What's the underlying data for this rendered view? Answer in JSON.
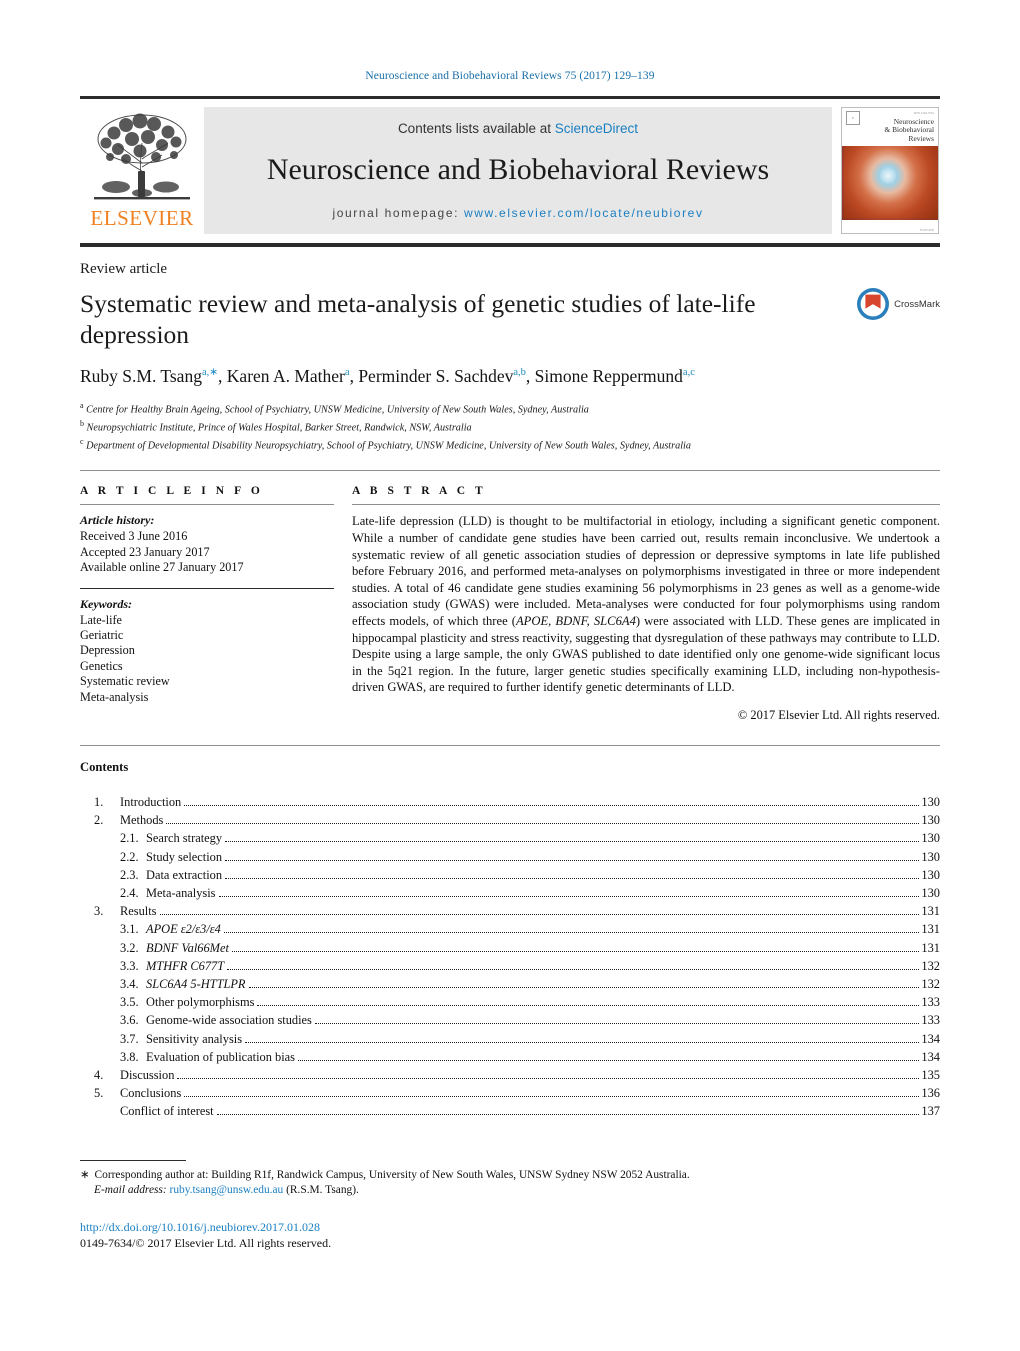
{
  "running_head": "Neuroscience and Biobehavioral Reviews 75 (2017) 129–139",
  "colors": {
    "link_blue": "#1a7fc1",
    "elsevier_orange": "#f08122",
    "running_head_blue": "#1a6fa8",
    "superscript_teal": "#1f8bbf",
    "masthead_gray": "#e7e7e7"
  },
  "masthead": {
    "contents_prefix": "Contents lists available at ",
    "contents_link": "ScienceDirect",
    "journal_title": "Neuroscience and Biobehavioral Reviews",
    "homepage_prefix": "journal homepage:",
    "homepage_url": "www.elsevier.com/locate/neubiorev",
    "publisher_wordmark": "ELSEVIER",
    "publisher_logo_icon": "elsevier-tree-icon",
    "cover": {
      "title_line_1": "Neuroscience",
      "title_line_2": "& Biobehavioral",
      "title_line_3": "Reviews",
      "top_meta": "ISSN 0149-7634",
      "bottom_meta": "ELSEVIER"
    }
  },
  "article": {
    "kicker": "Review article",
    "title": "Systematic review and meta-analysis of genetic studies of late-life depression",
    "crossmark_label": "CrossMark",
    "crossmark_icon": "crossmark-icon",
    "authors": [
      {
        "name": "Ruby S.M. Tsang",
        "sup": "a,∗"
      },
      {
        "name": "Karen A. Mather",
        "sup": "a"
      },
      {
        "name": "Perminder S. Sachdev",
        "sup": "a,b"
      },
      {
        "name": "Simone Reppermund",
        "sup": "a,c"
      }
    ],
    "affiliations": [
      {
        "marker": "a",
        "text": "Centre for Healthy Brain Ageing, School of Psychiatry, UNSW Medicine, University of New South Wales, Sydney, Australia"
      },
      {
        "marker": "b",
        "text": "Neuropsychiatric Institute, Prince of Wales Hospital, Barker Street, Randwick, NSW, Australia"
      },
      {
        "marker": "c",
        "text": "Department of Developmental Disability Neuropsychiatry, School of Psychiatry, UNSW Medicine, University of New South Wales, Sydney, Australia"
      }
    ]
  },
  "info": {
    "label": "A R T I C L E   I N F O",
    "history_head": "Article history:",
    "history": [
      "Received 3 June 2016",
      "Accepted 23 January 2017",
      "Available online 27 January 2017"
    ],
    "keywords_head": "Keywords:",
    "keywords": [
      "Late-life",
      "Geriatric",
      "Depression",
      "Genetics",
      "Systematic review",
      "Meta-analysis"
    ]
  },
  "abstract": {
    "label": "A B S T R A C T",
    "paragraph_part_1": "Late-life depression (LLD) is thought to be multifactorial in etiology, including a significant genetic component. While a number of candidate gene studies have been carried out, results remain inconclusive. We undertook a systematic review of all genetic association studies of depression or depressive symptoms in late life published before February 2016, and performed meta-analyses on polymorphisms investigated in three or more independent studies. A total of 46 candidate gene studies examining 56 polymorphisms in 23 genes as well as a genome-wide association study (GWAS) were included. Meta-analyses were conducted for four polymorphisms using random effects models, of which three (",
    "genes_italic": "APOE, BDNF, SLC6A4",
    "paragraph_part_2": ") were associated with LLD. These genes are implicated in hippocampal plasticity and stress reactivity, suggesting that dysregulation of these pathways may contribute to LLD. Despite using a large sample, the only GWAS published to date identified only one genome-wide significant locus in the 5q21 region. In the future, larger genetic studies specifically examining LLD, including non-hypothesis-driven GWAS, are required to further identify genetic determinants of LLD.",
    "copyright": "© 2017 Elsevier Ltd. All rights reserved."
  },
  "contents": {
    "heading": "Contents",
    "entries": [
      {
        "level": 1,
        "num": "1.",
        "label": "Introduction",
        "page": "130"
      },
      {
        "level": 1,
        "num": "2.",
        "label": "Methods",
        "page": "130"
      },
      {
        "level": 2,
        "num": "2.1.",
        "label": "Search strategy",
        "page": "130"
      },
      {
        "level": 2,
        "num": "2.2.",
        "label": "Study selection",
        "page": "130"
      },
      {
        "level": 2,
        "num": "2.3.",
        "label": "Data extraction",
        "page": "130"
      },
      {
        "level": 2,
        "num": "2.4.",
        "label": "Meta-analysis",
        "page": "130"
      },
      {
        "level": 1,
        "num": "3.",
        "label": "Results",
        "page": "131"
      },
      {
        "level": 2,
        "num": "3.1.",
        "label": "APOE ε2/ε3/ε4",
        "italic": true,
        "page": "131"
      },
      {
        "level": 2,
        "num": "3.2.",
        "label": "BDNF Val66Met",
        "italic": true,
        "page": "131"
      },
      {
        "level": 2,
        "num": "3.3.",
        "label": "MTHFR C677T",
        "italic": true,
        "page": "132"
      },
      {
        "level": 2,
        "num": "3.4.",
        "label": "SLC6A4 5-HTTLPR",
        "italic": true,
        "page": "132"
      },
      {
        "level": 2,
        "num": "3.5.",
        "label": "Other polymorphisms",
        "page": "133"
      },
      {
        "level": 2,
        "num": "3.6.",
        "label": "Genome-wide association studies",
        "page": "133"
      },
      {
        "level": 2,
        "num": "3.7.",
        "label": "Sensitivity analysis",
        "page": "134"
      },
      {
        "level": 2,
        "num": "3.8.",
        "label": "Evaluation of publication bias",
        "page": "134"
      },
      {
        "level": 1,
        "num": "4.",
        "label": "Discussion",
        "page": "135"
      },
      {
        "level": 1,
        "num": "5.",
        "label": "Conclusions",
        "page": "136"
      },
      {
        "level": 3,
        "num": "",
        "label": "Conflict of interest",
        "page": "137"
      }
    ]
  },
  "footnotes": {
    "star": "∗",
    "corresponding": "Corresponding author at: Building R1f, Randwick Campus, University of New South Wales, UNSW Sydney NSW 2052 Australia.",
    "email_label": "E-mail address:",
    "email": "ruby.tsang@unsw.edu.au",
    "email_suffix": "(R.S.M. Tsang).",
    "doi": "http://dx.doi.org/10.1016/j.neubiorev.2017.01.028",
    "issn": "0149-7634/© 2017 Elsevier Ltd. All rights reserved."
  }
}
